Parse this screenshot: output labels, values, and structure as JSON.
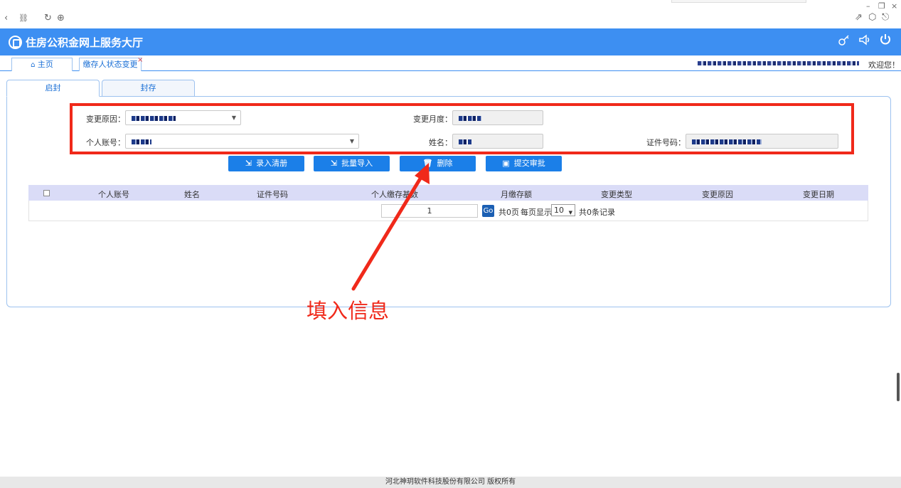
{
  "browser": {
    "back_glyph": "‹",
    "link_glyph": "⛓",
    "refresh_glyph": "↻",
    "globe_glyph": "⊕",
    "min_glyph": "–",
    "restore_glyph": "❐",
    "close_glyph": "×",
    "share_glyph": "⇗",
    "cube_glyph": "⬡",
    "exit_glyph": "⎋"
  },
  "header": {
    "title": "住房公积金网上服务大厅",
    "icons": [
      "key-icon",
      "speaker-icon",
      "power-icon"
    ],
    "accent_color": "#3d8ff2"
  },
  "tabs": {
    "home_label": "主页",
    "active_label": "缴存人状态变更",
    "close_glyph": "×",
    "welcome": "欢迎您！"
  },
  "subtabs": {
    "open_label": "启封",
    "seal_label": "封存"
  },
  "form": {
    "reason_label": "变更原因：",
    "month_label": "变更月度：",
    "account_label": "个人账号：",
    "name_label": "姓名：",
    "idno_label": "证件号码："
  },
  "actions": {
    "enter_list": "录入清册",
    "batch_import": "批量导入",
    "delete": "删除",
    "submit": "提交审批"
  },
  "table": {
    "columns": [
      "个人账号",
      "姓名",
      "证件号码",
      "个人缴存基数",
      "月缴存额",
      "变更类型",
      "变更原因",
      "变更日期"
    ],
    "rows": []
  },
  "pagination": {
    "page_value": "1",
    "go_label": "Go",
    "total_pages_text": "共0页",
    "per_page_label": "每页显示",
    "per_page_value": "10",
    "total_records_text": "共0条记录"
  },
  "annotation": {
    "text": "填入信息",
    "color": "#f0291a"
  },
  "footer": {
    "copyright": "河北神玥软件科技股份有限公司 版权所有"
  }
}
